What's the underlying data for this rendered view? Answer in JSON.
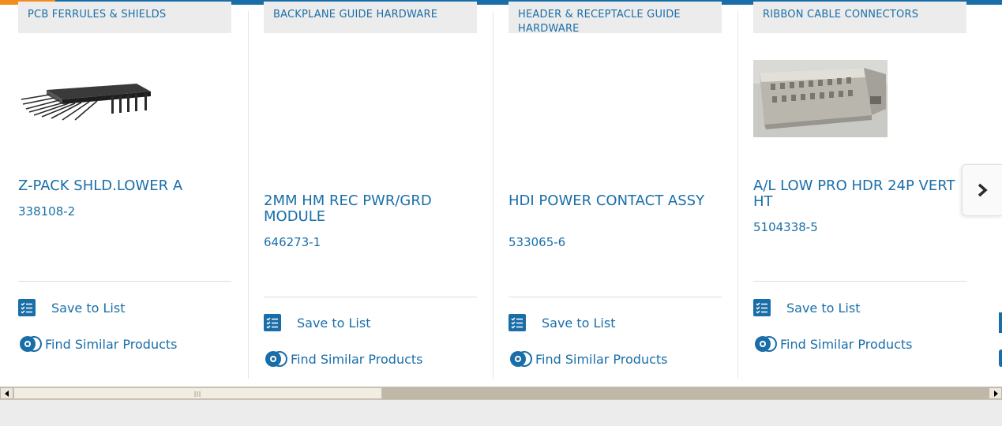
{
  "theme": {
    "accent": "#1a6ea8",
    "highlight": "#f28c1e",
    "category_bg": "#ececec"
  },
  "cards": [
    {
      "category": "PCB FERRULES & SHIELDS",
      "title": "Z-PACK SHLD.LOWER A",
      "part_number": "338108-2",
      "save_label": "Save to List",
      "similar_label": "Find Similar Products",
      "image": "pcb-shield-product-image"
    },
    {
      "category": "BACKPLANE GUIDE HARDWARE",
      "title": "2MM HM REC PWR/GRD MODULE",
      "part_number": "646273-1",
      "save_label": "Save to List",
      "similar_label": "Find Similar Products"
    },
    {
      "category": "HEADER & RECEPTACLE GUIDE HARDWARE",
      "title": "HDI POWER CONTACT ASSY",
      "part_number": "533065-6",
      "save_label": "Save to List",
      "similar_label": "Find Similar Products"
    },
    {
      "category": "RIBBON CABLE CONNECTORS",
      "title": "A/L LOW PRO HDR 24P VERT HT",
      "part_number": "5104338-5",
      "save_label": "Save to List",
      "similar_label": "Find Similar Products",
      "image": "ribbon-header-product-image"
    }
  ],
  "carousel": {
    "next_icon": "chevron-right-icon"
  },
  "scrollbar": {
    "left_icon": "arrow-left-icon",
    "right_icon": "arrow-right-icon"
  }
}
